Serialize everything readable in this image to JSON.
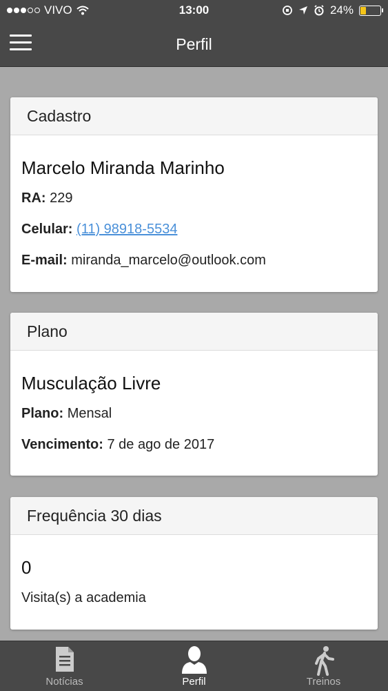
{
  "status_bar": {
    "carrier": "VIVO",
    "time": "13:00",
    "battery": "24%",
    "battery_level": 0.24
  },
  "header": {
    "title": "Perfil",
    "menu_icon": "hamburger-menu-icon"
  },
  "cadastro": {
    "title": "Cadastro",
    "name": "Marcelo Miranda Marinho",
    "ra_label": "RA:",
    "ra_value": "229",
    "celular_label": "Celular:",
    "celular_value": "(11) 98918-5534",
    "email_label": "E-mail:",
    "email_value": "miranda_marcelo@outlook.com"
  },
  "plano": {
    "title": "Plano",
    "name": "Musculação Livre",
    "plano_label": "Plano:",
    "plano_value": "Mensal",
    "vencimento_label": "Vencimento:",
    "vencimento_value": "7 de ago de 2017"
  },
  "frequencia": {
    "title": "Frequência 30 dias",
    "count": "0",
    "caption": "Visita(s) a academia"
  },
  "tabs": [
    {
      "label": "Notícias",
      "icon": "document-icon",
      "active": false
    },
    {
      "label": "Perfil",
      "icon": "person-icon",
      "active": true
    },
    {
      "label": "Treinos",
      "icon": "walking-icon",
      "active": false
    }
  ]
}
